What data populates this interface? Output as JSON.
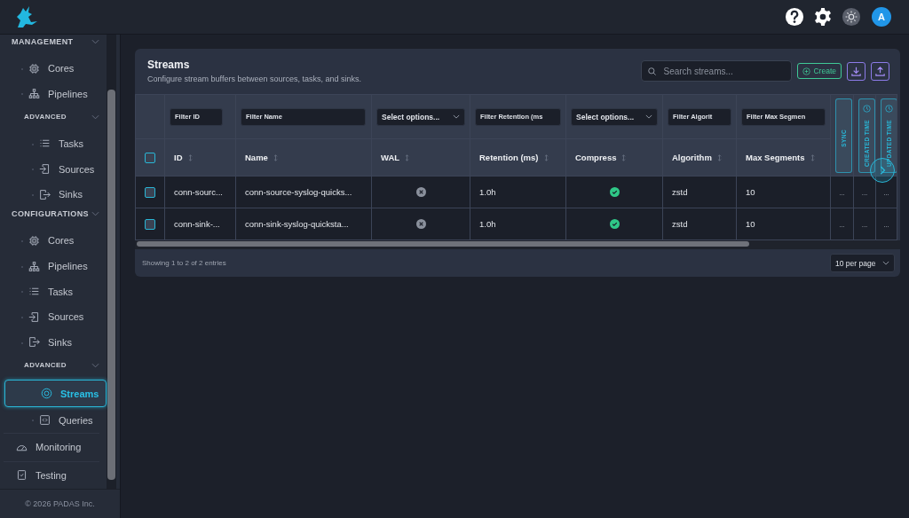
{
  "top_bar": {
    "avatar": "A"
  },
  "sidebar": {
    "nav": [
      {
        "kind": "section",
        "label": "MANAGEMENT",
        "expanded": true,
        "children": [
          {
            "kind": "item",
            "label": "Cores",
            "selected": false
          },
          {
            "kind": "item",
            "label": "Pipelines",
            "selected": false
          },
          {
            "kind": "section",
            "label": "ADVANCED",
            "expanded": true,
            "children": [
              {
                "kind": "item",
                "label": "Tasks",
                "selected": false
              },
              {
                "kind": "item",
                "label": "Sources",
                "selected": false
              },
              {
                "kind": "item",
                "label": "Sinks",
                "selected": false
              }
            ]
          }
        ]
      },
      {
        "kind": "section",
        "label": "CONFIGURATIONS",
        "expanded": true,
        "children": [
          {
            "kind": "item",
            "label": "Cores",
            "selected": false
          },
          {
            "kind": "item",
            "label": "Pipelines",
            "selected": false
          },
          {
            "kind": "item",
            "label": "Tasks",
            "selected": false
          },
          {
            "kind": "item",
            "label": "Sources",
            "selected": false
          },
          {
            "kind": "item",
            "label": "Sinks",
            "selected": false
          },
          {
            "kind": "section",
            "label": "ADVANCED",
            "expanded": true,
            "children": [
              {
                "kind": "item",
                "label": "Streams",
                "selected": true
              },
              {
                "kind": "item",
                "label": "Queries",
                "selected": false
              }
            ]
          }
        ]
      },
      {
        "kind": "top",
        "label": "Monitoring",
        "selected": false
      },
      {
        "kind": "top",
        "label": "Testing",
        "selected": false
      }
    ],
    "footer": "© 2026 PADAS Inc."
  },
  "page": {
    "title": "Streams",
    "subtitle": "Configure stream buffers between sources, tasks, and sinks.",
    "search": {
      "placeholder": "Search streams..."
    },
    "create_button": "Create"
  },
  "table": {
    "select_all": {
      "checked": false
    },
    "columns": [
      {
        "kind": "text",
        "label": "ID",
        "filter": {
          "kind": "input",
          "placeholder": "Filter ID"
        }
      },
      {
        "kind": "text",
        "label": "Name",
        "filter": {
          "kind": "input",
          "placeholder": "Filter Name"
        }
      },
      {
        "kind": "bool",
        "label": "WAL",
        "filter": {
          "kind": "select",
          "placeholder": "Select options..."
        }
      },
      {
        "kind": "text",
        "label": "Retention (ms)",
        "filter": {
          "kind": "input",
          "placeholder": "Filter Retention (ms"
        }
      },
      {
        "kind": "bool",
        "label": "Compress",
        "filter": {
          "kind": "select",
          "placeholder": "Select options..."
        }
      },
      {
        "kind": "text",
        "label": "Algorithm",
        "filter": {
          "kind": "input",
          "placeholder": "Filter Algorit"
        }
      },
      {
        "kind": "text",
        "label": "Max Segments",
        "filter": {
          "kind": "input",
          "placeholder": "Filter Max Segmen"
        }
      },
      {
        "kind": "vertical",
        "label": "SYNC",
        "clock": false
      },
      {
        "kind": "vertical",
        "label": "CREATED TIME",
        "clock": true
      },
      {
        "kind": "vertical",
        "label": "UPDATED TIME",
        "clock": true
      }
    ],
    "rows": [
      {
        "selected": false,
        "cells": [
          "conn-sourc...",
          "conn-source-syslog-quicks...",
          false,
          "1.0h",
          true,
          "zstd",
          "10",
          "...",
          "...",
          "..."
        ]
      },
      {
        "selected": false,
        "cells": [
          "conn-sink-...",
          "conn-sink-syslog-quicksta...",
          false,
          "1.0h",
          true,
          "zstd",
          "10",
          "...",
          "...",
          "..."
        ]
      }
    ],
    "summary": "Showing 1 to 2 of 2 entries",
    "page_size": "10 per page"
  }
}
